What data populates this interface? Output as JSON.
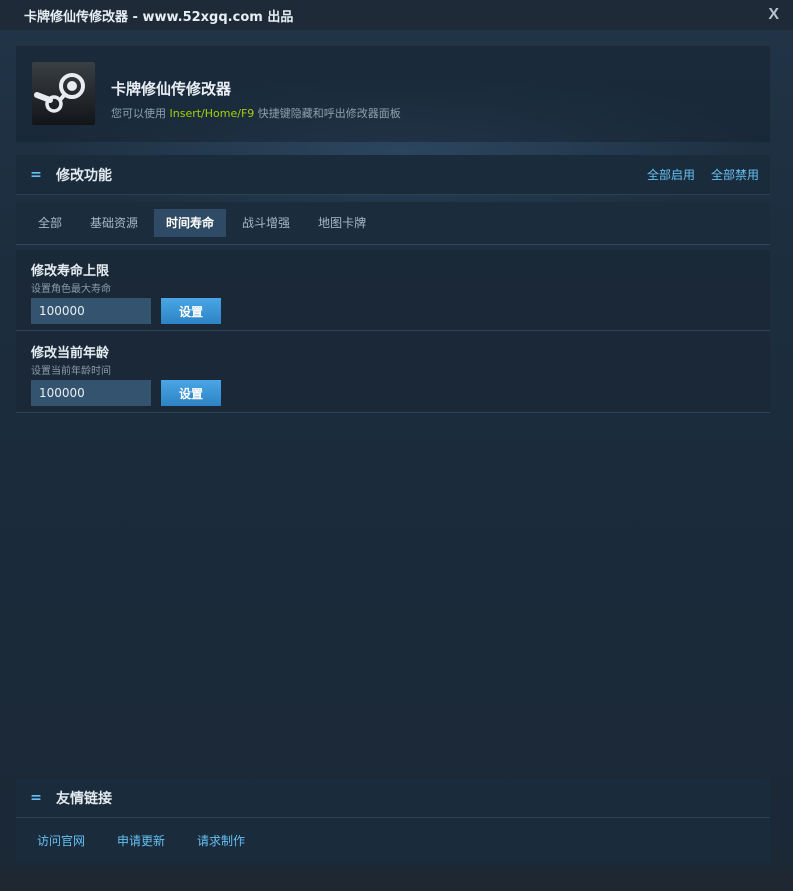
{
  "window": {
    "title": "卡牌修仙传修改器 - www.52xgq.com 出品",
    "close_label": "X"
  },
  "header": {
    "app_name": "卡牌修仙传修改器",
    "hint_prefix": "您可以使用 ",
    "hint_hotkeys": "Insert/Home/F9",
    "hint_suffix": " 快捷键隐藏和呼出修改器面板",
    "hotkey_color": "#a4d007"
  },
  "functions": {
    "marker": "=",
    "title": "修改功能",
    "enable_all": "全部启用",
    "disable_all": "全部禁用"
  },
  "tabs": [
    {
      "label": "全部",
      "active": false
    },
    {
      "label": "基础资源",
      "active": false
    },
    {
      "label": "时间寿命",
      "active": true
    },
    {
      "label": "战斗增强",
      "active": false
    },
    {
      "label": "地图卡牌",
      "active": false
    }
  ],
  "features": [
    {
      "title": "修改寿命上限",
      "desc": "设置角色最大寿命",
      "value": "100000",
      "button": "设置"
    },
    {
      "title": "修改当前年龄",
      "desc": "设置当前年龄时间",
      "value": "100000",
      "button": "设置"
    }
  ],
  "links": {
    "marker": "=",
    "title": "友情链接",
    "items": [
      "访问官网",
      "申请更新",
      "请求制作"
    ]
  },
  "colors": {
    "accent": "#66c0f4",
    "background": "#1b2838"
  }
}
